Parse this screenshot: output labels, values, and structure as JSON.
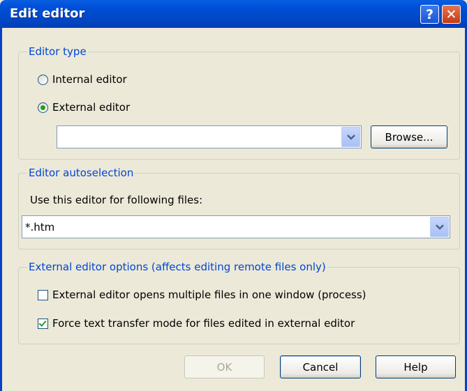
{
  "window": {
    "title": "Edit editor",
    "help_glyph": "?",
    "close_glyph": "✕"
  },
  "editor_type": {
    "legend": "Editor type",
    "internal_label": "Internal editor",
    "external_label": "External editor",
    "selected": "external",
    "path_value": "",
    "browse_label": "Browse..."
  },
  "autoselection": {
    "legend": "Editor autoselection",
    "label": "Use this editor for following files:",
    "mask_value": "*.htm"
  },
  "options": {
    "legend": "External editor options (affects editing remote files only)",
    "multiple_files_label": "External editor opens multiple files in one window (process)",
    "multiple_files_checked": false,
    "force_text_label": "Force text transfer mode for files edited in external editor",
    "force_text_checked": true
  },
  "buttons": {
    "ok": "OK",
    "cancel": "Cancel",
    "help": "Help"
  }
}
